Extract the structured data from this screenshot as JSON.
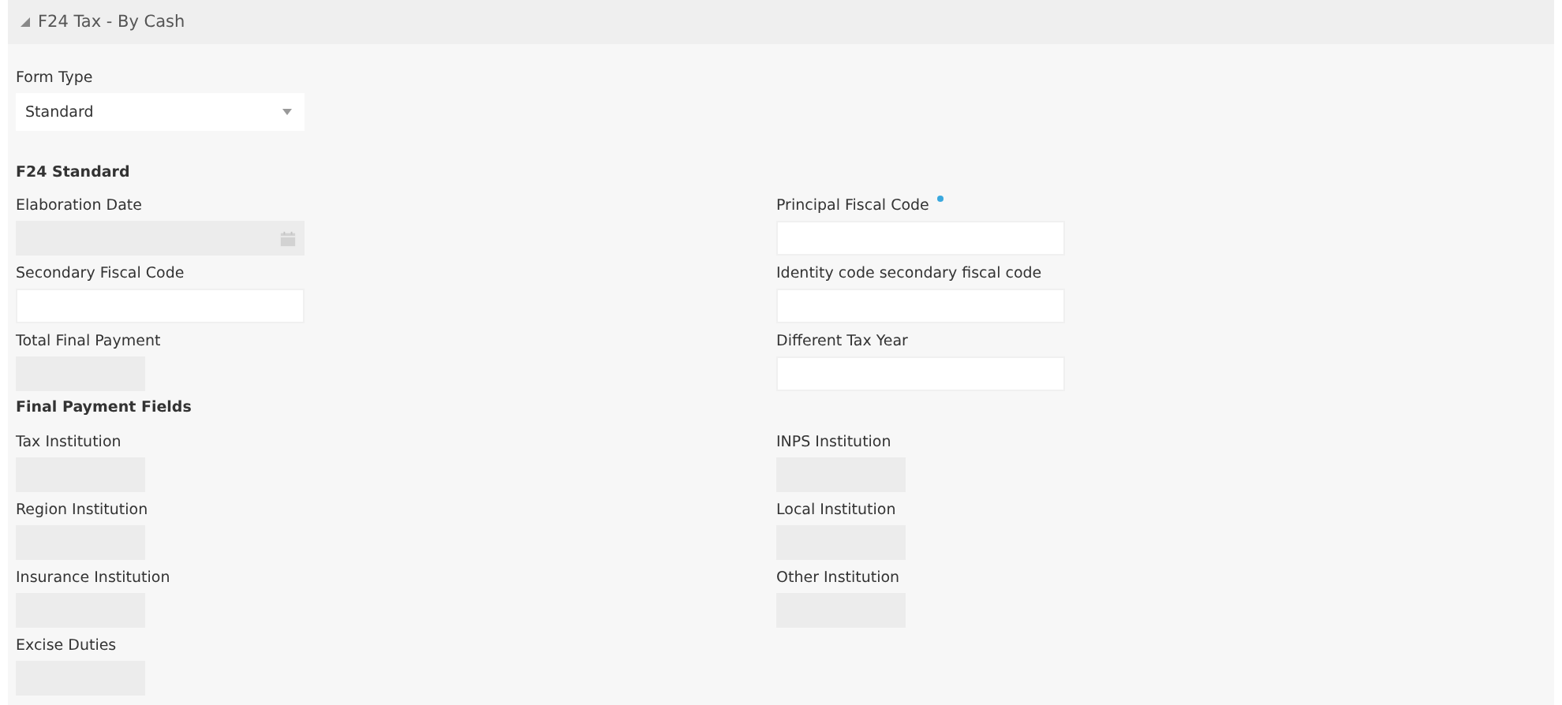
{
  "panel": {
    "title": "F24 Tax - By Cash",
    "expanded": true
  },
  "form_type": {
    "label": "Form Type",
    "value": "Standard"
  },
  "sections": [
    {
      "heading": "F24 Standard",
      "rows": [
        {
          "left": {
            "label": "Elaboration Date",
            "kind": "date",
            "disabled": true,
            "required": false
          },
          "right": {
            "label": "Principal Fiscal Code",
            "kind": "text",
            "disabled": false,
            "required": true
          }
        },
        {
          "left": {
            "label": "Secondary Fiscal Code",
            "kind": "text",
            "disabled": false,
            "required": false
          },
          "right": {
            "label": "Identity code secondary fiscal code",
            "kind": "text",
            "disabled": false,
            "required": false
          }
        },
        {
          "left": {
            "label": "Total Final Payment",
            "kind": "short",
            "disabled": true,
            "required": false
          },
          "right": {
            "label": "Different Tax Year",
            "kind": "text",
            "disabled": false,
            "required": false
          }
        }
      ]
    },
    {
      "heading": "Final Payment Fields",
      "rows": [
        {
          "left": {
            "label": "Tax Institution",
            "kind": "short",
            "disabled": true,
            "required": false
          },
          "right": {
            "label": "INPS Institution",
            "kind": "short",
            "disabled": true,
            "required": false
          }
        },
        {
          "left": {
            "label": "Region Institution",
            "kind": "short",
            "disabled": true,
            "required": false
          },
          "right": {
            "label": "Local Institution",
            "kind": "short",
            "disabled": true,
            "required": false
          }
        },
        {
          "left": {
            "label": "Insurance Institution",
            "kind": "short",
            "disabled": true,
            "required": false
          },
          "right": {
            "label": "Other Institution",
            "kind": "short",
            "disabled": true,
            "required": false
          }
        },
        {
          "left": {
            "label": "Excise Duties",
            "kind": "short",
            "disabled": true,
            "required": false
          }
        }
      ]
    }
  ]
}
